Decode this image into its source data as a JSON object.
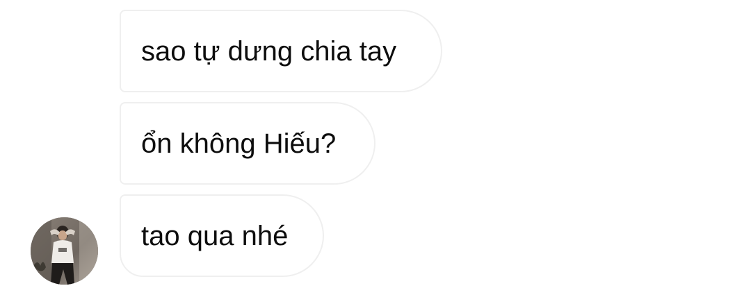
{
  "messages": [
    {
      "text": "sao tự dưng chia tay"
    },
    {
      "text": "ổn không Hiếu?"
    },
    {
      "text": "tao qua nhé"
    }
  ],
  "colors": {
    "bubble_border": "#efefef",
    "bubble_bg": "#ffffff",
    "text": "#0d0d0d",
    "background": "#ffffff"
  },
  "icons": {
    "avatar": "contact-avatar-photo"
  }
}
